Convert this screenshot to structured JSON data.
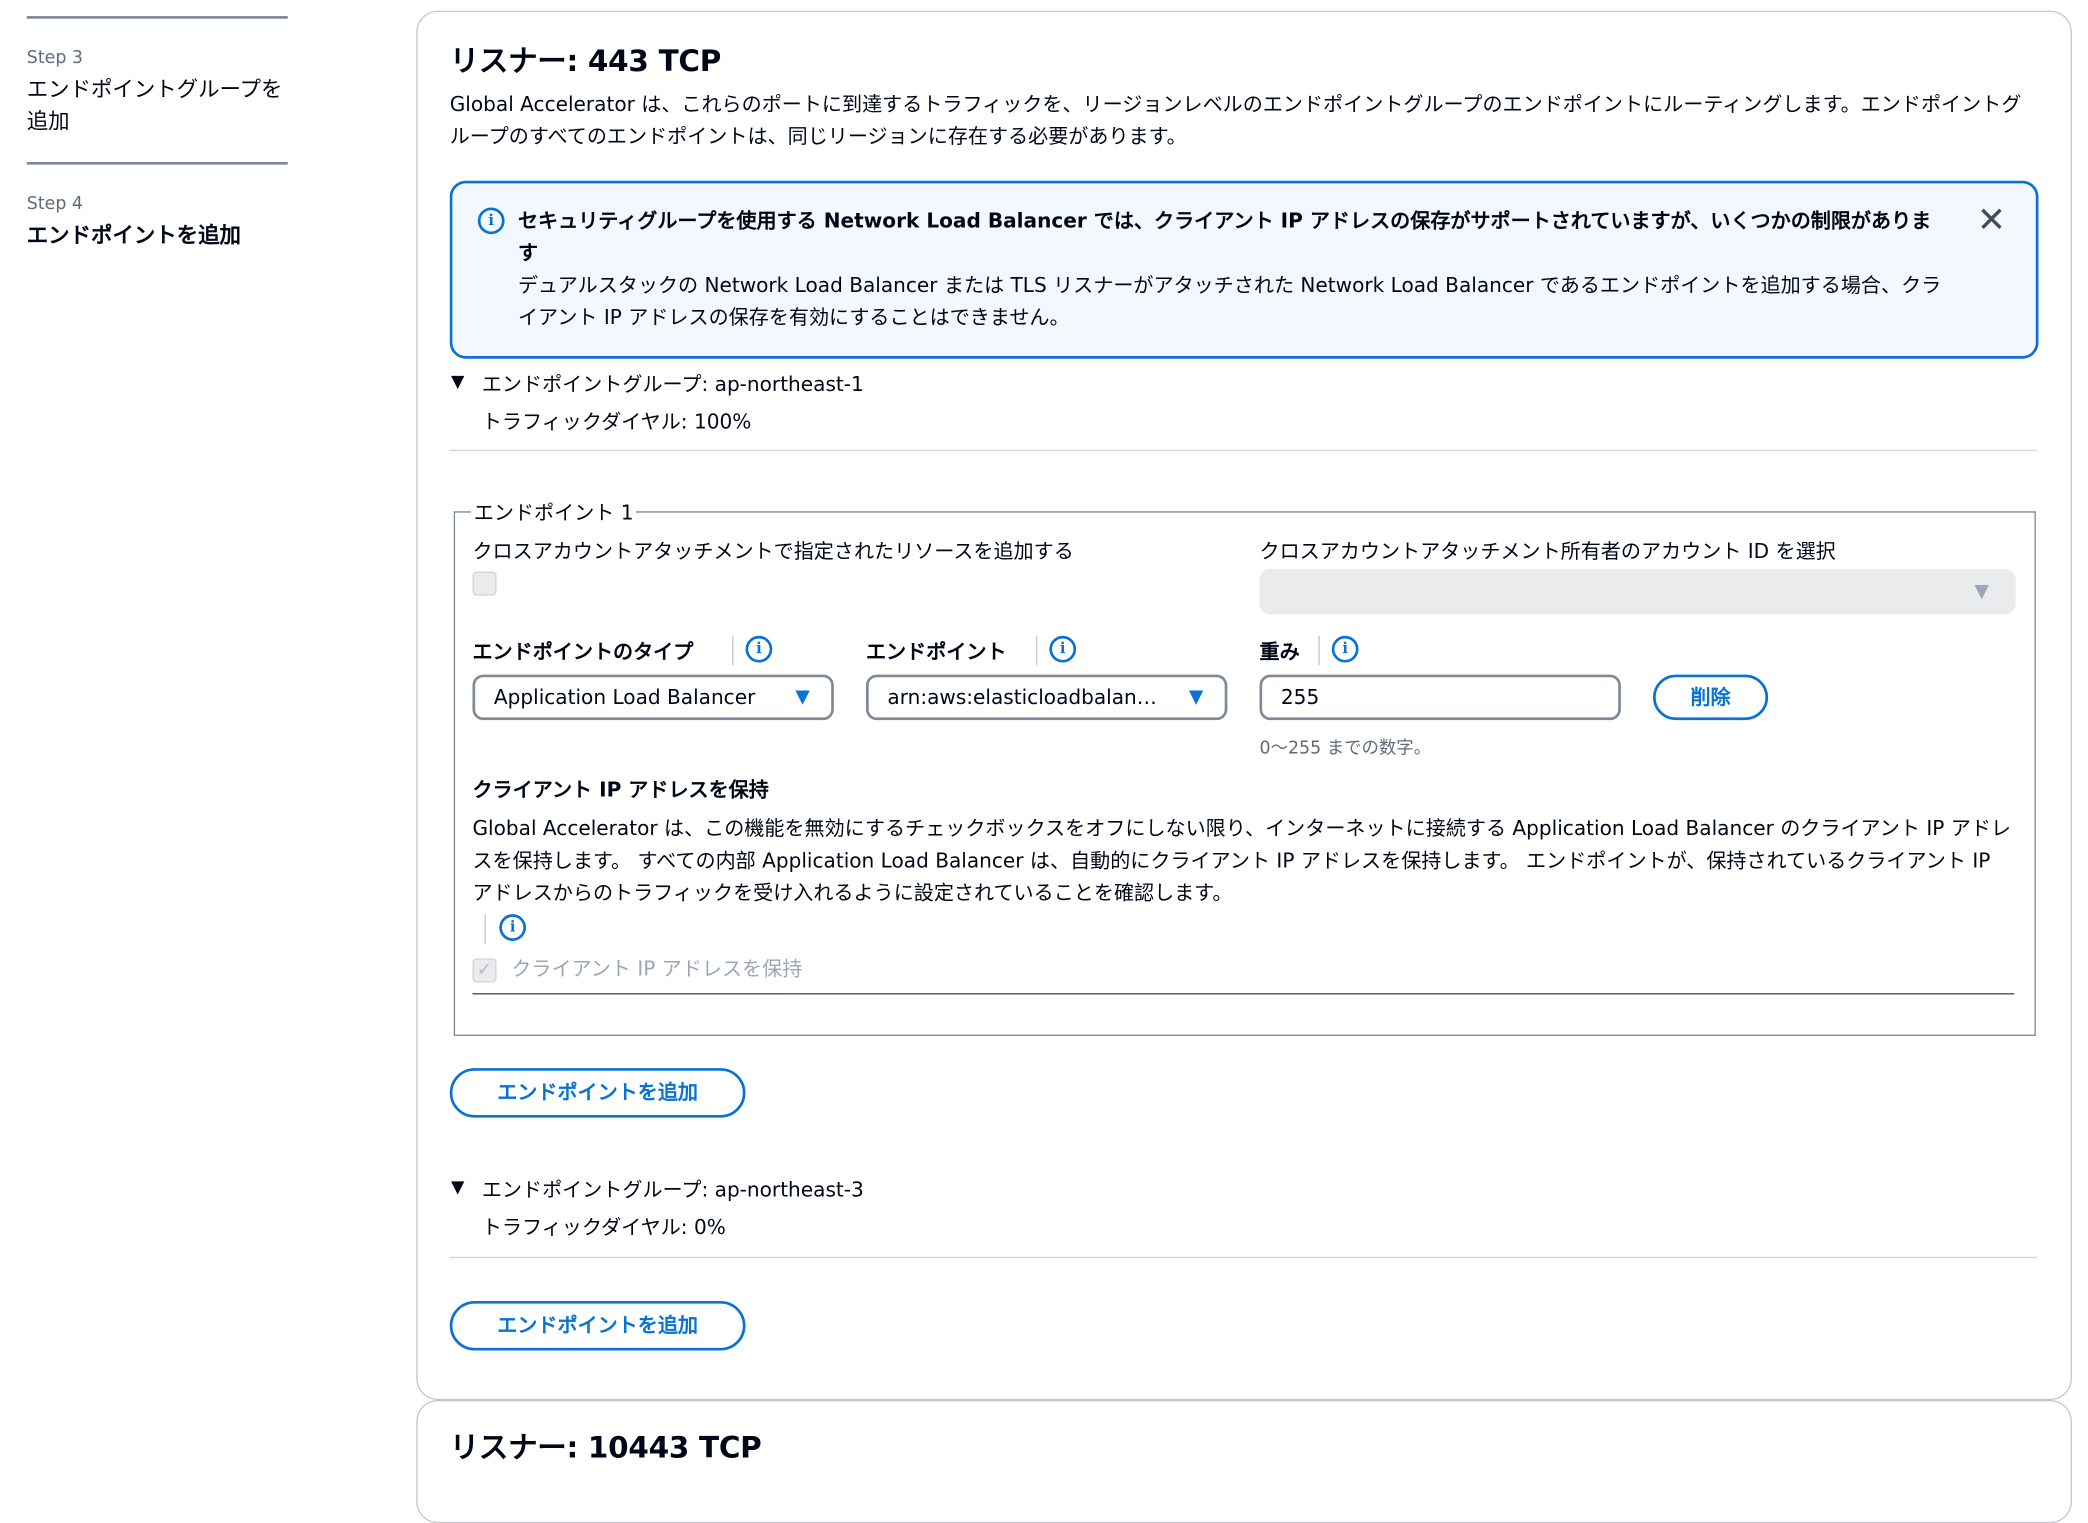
{
  "sidebar": {
    "steps": [
      {
        "num": "Step 3",
        "title": "エンドポイントグループを追加"
      },
      {
        "num": "Step 4",
        "title": "エンドポイントを追加"
      }
    ]
  },
  "listener1": {
    "title": "リスナー: 443 TCP",
    "desc": "Global Accelerator は、これらのポートに到達するトラフィックを、リージョンレベルのエンドポイントグループのエンドポイントにルーティングします。エンドポイントグループのすべてのエンドポイントは、同じリージョンに存在する必要があります。",
    "alert": {
      "title": "セキュリティグループを使用する Network Load Balancer では、クライアント IP アドレスの保存がサポートされていますが、いくつかの制限があります",
      "body": "デュアルスタックの Network Load Balancer または TLS リスナーがアタッチされた Network Load Balancer であるエンドポイントを追加する場合、クライアント IP アドレスの保存を有効にすることはできません。"
    },
    "group1": {
      "title": "エンドポイントグループ: ap-northeast-1",
      "dial": "トラフィックダイヤル: 100%",
      "endpoint": {
        "legend": "エンドポイント 1",
        "cross_account_label": "クロスアカウントアタッチメントで指定されたリソースを追加する",
        "cross_account_owner_label": "クロスアカウントアタッチメント所有者のアカウント ID を選択",
        "cross_account_checked": false,
        "type_label": "エンドポイントのタイプ",
        "type_value": "Application Load Balancer",
        "endpoint_label": "エンドポイント",
        "endpoint_value": "arn:aws:elasticloadbalan…",
        "weight_label": "重み",
        "weight_value": "255",
        "weight_hint": "0〜255 までの数字。",
        "delete_label": "削除",
        "preserve_title": "クライアント IP アドレスを保持",
        "preserve_desc": "Global Accelerator は、この機能を無効にするチェックボックスをオフにしない限り、インターネットに接続する Application Load Balancer のクライアント IP アドレスを保持します。 すべての内部 Application Load Balancer は、自動的にクライアント IP アドレスを保持します。 エンドポイントが、保持されているクライアント IP アドレスからのトラフィックを受け入れるように設定されていることを確認します。",
        "preserve_checkbox_label": "クライアント IP アドレスを保持",
        "preserve_checked": true
      },
      "add_endpoint_label": "エンドポイントを追加"
    },
    "group2": {
      "title": "エンドポイントグループ: ap-northeast-3",
      "dial": "トラフィックダイヤル: 0%",
      "add_endpoint_label": "エンドポイントを追加"
    }
  },
  "listener2": {
    "title": "リスナー: 10443 TCP"
  },
  "colors": {
    "accent": "#0972d3",
    "alert_bg": "#f2f8fd",
    "text": "#000716",
    "muted": "#5f6b7a"
  }
}
